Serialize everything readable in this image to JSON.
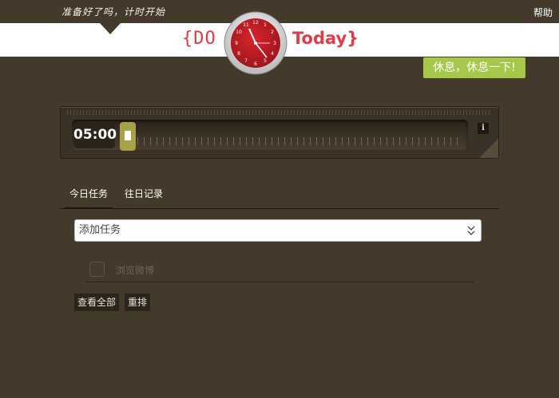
{
  "header": {
    "tagline": "准备好了吗，计时开始",
    "help_label": "帮助",
    "logo_left": "{DO",
    "logo_right": "Today}",
    "rest_button": "休息，休息一下!"
  },
  "timer": {
    "time": "05:00",
    "info_label": "i",
    "slider_fraction": 0.0
  },
  "tabs": [
    {
      "label": "今日任务",
      "active": true
    },
    {
      "label": "往日记录",
      "active": false
    }
  ],
  "add_task": {
    "value": "添加任务",
    "chevron": "⌄"
  },
  "tasks": [
    {
      "label": "浏览微博",
      "checked": false
    }
  ],
  "actions": {
    "view_all": "查看全部",
    "reorder": "重排"
  },
  "colors": {
    "background": "#433a2b",
    "accent_red": "#e23a46",
    "rest_green": "#a6c84a",
    "slider_olive": "#a6a248"
  },
  "icons": [
    "clock-icon",
    "info-icon",
    "chevron-down-icon",
    "pointer-triangle"
  ]
}
